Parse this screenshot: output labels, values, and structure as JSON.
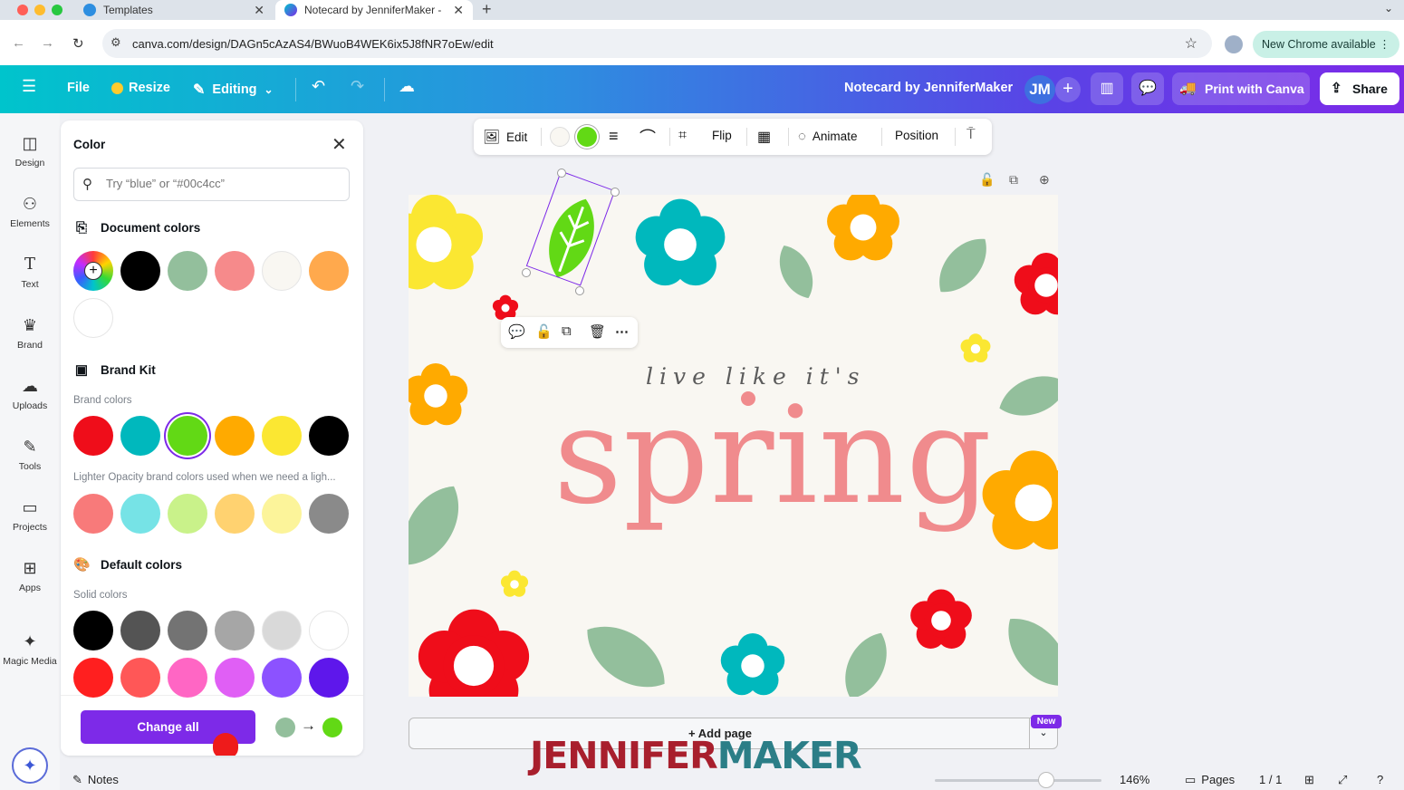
{
  "browser": {
    "tabs": [
      {
        "title": "Templates"
      },
      {
        "title": "Notecard by JenniferMaker -"
      }
    ],
    "url": "canva.com/design/DAGn5cAzAS4/BWuoB4WEK6ix5J8fNR7oEw/edit",
    "new_chrome": "New Chrome available"
  },
  "header": {
    "file": "File",
    "resize": "Resize",
    "editing": "Editing",
    "doc_title": "Notecard by JenniferMaker",
    "avatar": "JM",
    "print": "Print with Canva",
    "share": "Share"
  },
  "rail": {
    "items": [
      {
        "label": "Design",
        "icon": "design-icon"
      },
      {
        "label": "Elements",
        "icon": "elements-icon"
      },
      {
        "label": "Text",
        "icon": "text-icon"
      },
      {
        "label": "Brand",
        "icon": "brand-icon"
      },
      {
        "label": "Uploads",
        "icon": "uploads-icon"
      },
      {
        "label": "Tools",
        "icon": "tools-icon"
      },
      {
        "label": "Projects",
        "icon": "projects-icon"
      },
      {
        "label": "Apps",
        "icon": "apps-icon"
      },
      {
        "label": "Magic Media",
        "icon": "magic-media-icon"
      }
    ]
  },
  "color_panel": {
    "title": "Color",
    "search_placeholder": "Try “blue” or “#00c4cc”",
    "document_colors_title": "Document colors",
    "document_colors": [
      "#000000",
      "#93bf9c",
      "#f68a8b",
      "#f9f7f2",
      "#ffa94d",
      "#ffffff"
    ],
    "brand_kit_title": "Brand Kit",
    "brand_colors_label": "Brand colors",
    "brand_colors": [
      "#ef0d1a",
      "#00b8bd",
      "#62d915",
      "#ffaa00",
      "#fbe732",
      "#000000"
    ],
    "brand_selected": "#62d915",
    "lighter_label": "Lighter Opacity brand colors used when we need a ligh...",
    "lighter_colors": [
      "#f87a7a",
      "#76e3e6",
      "#c9f28a",
      "#ffd270",
      "#fcf49a",
      "#8a8a8a"
    ],
    "default_colors_title": "Default colors",
    "solid_colors_label": "Solid colors",
    "solid_row1": [
      "#000000",
      "#545454",
      "#737373",
      "#a6a6a6",
      "#d9d9d9",
      "#ffffff"
    ],
    "solid_row2": [
      "#ff1f1f",
      "#ff5757",
      "#ff66c4",
      "#e05ff5",
      "#8c52ff",
      "#5e17eb"
    ],
    "change_all": "Change all",
    "change_from": "#93bf9c",
    "change_to": "#62d915"
  },
  "float_toolbar": {
    "edit": "Edit",
    "color1": "#f9f7f2",
    "color2": "#62d915",
    "flip": "Flip",
    "animate": "Animate",
    "position": "Position"
  },
  "canvas": {
    "line1": "live like it's",
    "line2": "spring",
    "add_page": "+ Add page",
    "new_badge": "New"
  },
  "watermark": {
    "part1": "JENNIFER",
    "part2": "MAKER"
  },
  "bottom": {
    "notes": "Notes",
    "zoom": "146%",
    "pages": "Pages",
    "page_count": "1 / 1"
  }
}
